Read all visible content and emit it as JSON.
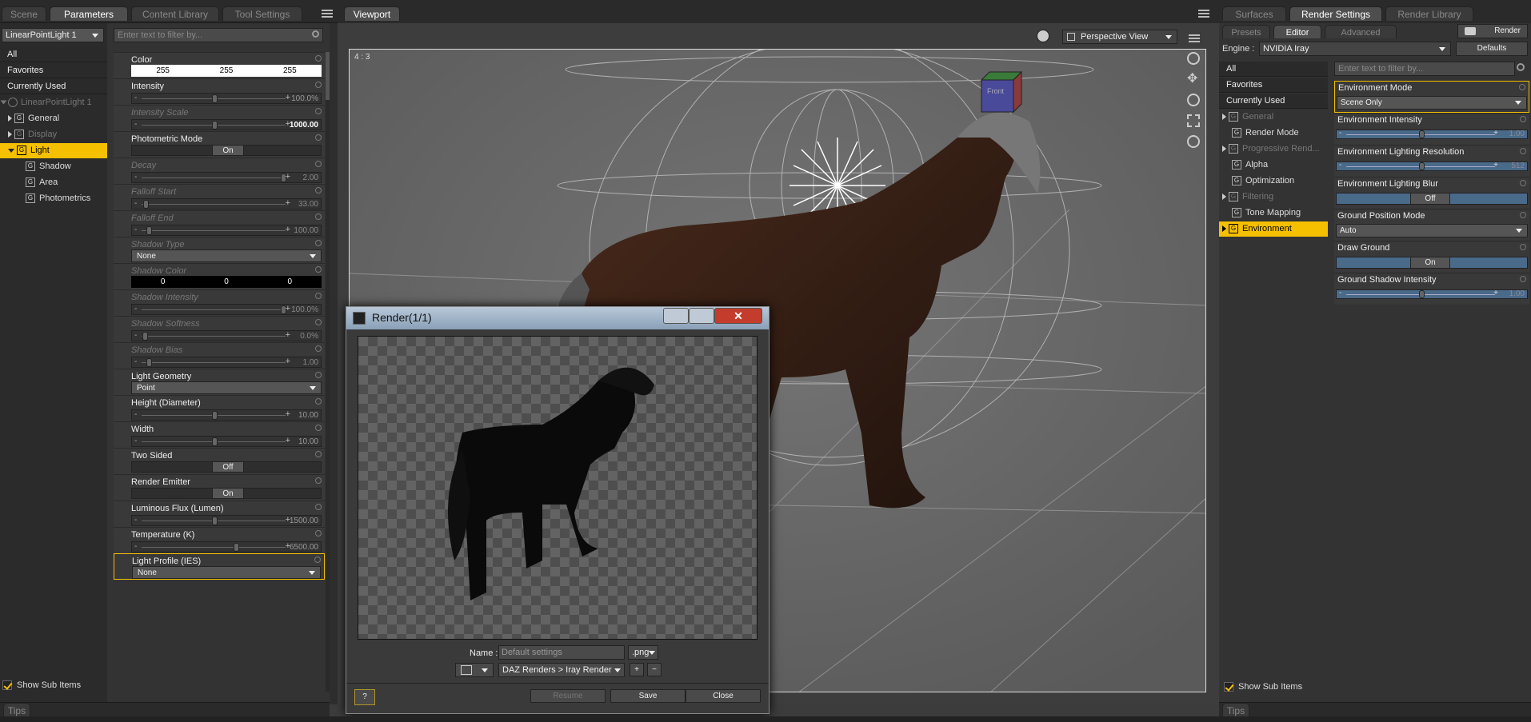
{
  "left_tabs": [
    "Scene",
    "Parameters",
    "Content Library",
    "Tool Settings"
  ],
  "left": {
    "selected_node": "LinearPointLight 1",
    "filter_placeholder": "Enter text to filter by...",
    "list": [
      "All",
      "Favorites",
      "Currently Used"
    ],
    "tree": {
      "root": "LinearPointLight 1",
      "items": [
        {
          "label": "General",
          "indent": 1,
          "state": "normal"
        },
        {
          "label": "Display",
          "indent": 1,
          "state": "dim"
        },
        {
          "label": "Light",
          "indent": 1,
          "state": "selected"
        },
        {
          "label": "Shadow",
          "indent": 2,
          "state": "normal"
        },
        {
          "label": "Area",
          "indent": 2,
          "state": "normal"
        },
        {
          "label": "Photometrics",
          "indent": 2,
          "state": "normal"
        }
      ]
    },
    "show_sub_items": "Show Sub Items"
  },
  "params": [
    {
      "label": "Color",
      "kind": "color",
      "values": [
        "255",
        "255",
        "255"
      ],
      "dim": false
    },
    {
      "label": "Intensity",
      "kind": "slider",
      "value": "100.0%",
      "pos": 0.5,
      "dim": false
    },
    {
      "label": "Intensity Scale",
      "kind": "slider",
      "value": "1000.00",
      "pos": 0.5,
      "dim": true
    },
    {
      "label": "Photometric Mode",
      "kind": "toggle",
      "value": "On",
      "dim": false
    },
    {
      "label": "Decay",
      "kind": "slider",
      "value": "2.00",
      "pos": 0.97,
      "dim": true
    },
    {
      "label": "Falloff Start",
      "kind": "slider",
      "value": "33.00",
      "pos": 0.03,
      "dim": true
    },
    {
      "label": "Falloff End",
      "kind": "slider",
      "value": "100.00",
      "pos": 0.05,
      "dim": true
    },
    {
      "label": "Shadow Type",
      "kind": "dropdown",
      "value": "None",
      "dim": true
    },
    {
      "label": "Shadow Color",
      "kind": "color_dark",
      "values": [
        "0",
        "0",
        "0"
      ],
      "dim": true
    },
    {
      "label": "Shadow Intensity",
      "kind": "slider",
      "value": "100.0%",
      "pos": 0.97,
      "dim": true
    },
    {
      "label": "Shadow Softness",
      "kind": "slider",
      "value": "0.0%",
      "pos": 0.02,
      "dim": true
    },
    {
      "label": "Shadow Bias",
      "kind": "slider",
      "value": "1.00",
      "pos": 0.05,
      "dim": true
    },
    {
      "label": "Light Geometry",
      "kind": "dropdown",
      "value": "Point",
      "dim": false
    },
    {
      "label": "Height (Diameter)",
      "kind": "slider",
      "value": "10.00",
      "pos": 0.5,
      "dim": false
    },
    {
      "label": "Width",
      "kind": "slider",
      "value": "10.00",
      "pos": 0.5,
      "dim": false
    },
    {
      "label": "Two Sided",
      "kind": "toggle",
      "value": "Off",
      "dim": false
    },
    {
      "label": "Render Emitter",
      "kind": "toggle",
      "value": "On",
      "dim": false
    },
    {
      "label": "Luminous Flux (Lumen)",
      "kind": "slider",
      "value": "1500.00",
      "pos": 0.5,
      "dim": false
    },
    {
      "label": "Temperature (K)",
      "kind": "slider",
      "value": "6500.00",
      "pos": 0.65,
      "dim": false
    },
    {
      "label": "Light Profile (IES)",
      "kind": "dropdown",
      "value": "None",
      "dim": false,
      "highlight": true
    }
  ],
  "viewport": {
    "tab": "Viewport",
    "aspect": "4 : 3",
    "view": "Perspective View",
    "cube_label": "Front"
  },
  "render_dialog": {
    "title": "Render(1/1)",
    "name_label": "Name :",
    "name_value": "Default settings",
    "ext": ".png",
    "path": "DAZ Renders > Iray Render",
    "plus": "+",
    "minus": "−",
    "help": "?",
    "resume": "Resume",
    "save": "Save",
    "close": "Close"
  },
  "right_tabs": [
    "Surfaces",
    "Render Settings",
    "Render Library"
  ],
  "right": {
    "subtabs": [
      "Presets",
      "Editor",
      "Advanced"
    ],
    "render_button": "Render",
    "engine_label": "Engine :",
    "engine_value": "NVIDIA Iray",
    "defaults_button": "Defaults",
    "filter_placeholder": "Enter text to filter by...",
    "list": [
      "All",
      "Favorites",
      "Currently Used"
    ],
    "tree": [
      {
        "label": "General",
        "state": "dim",
        "arrow": true
      },
      {
        "label": "Render Mode",
        "state": "normal",
        "arrow": false
      },
      {
        "label": "Progressive Rend...",
        "state": "dim",
        "arrow": true
      },
      {
        "label": "Alpha",
        "state": "normal",
        "arrow": false
      },
      {
        "label": "Optimization",
        "state": "normal",
        "arrow": false
      },
      {
        "label": "Filtering",
        "state": "dim",
        "arrow": true
      },
      {
        "label": "Tone Mapping",
        "state": "normal",
        "arrow": false
      },
      {
        "label": "Environment",
        "state": "selected",
        "arrow": true
      }
    ],
    "props": [
      {
        "label": "Environment Mode",
        "kind": "dropdown",
        "value": "Scene Only",
        "highlight": true
      },
      {
        "label": "Environment Intensity",
        "kind": "slider",
        "value": "1.00",
        "pos": 0.5
      },
      {
        "label": "Environment Lighting Resolution",
        "kind": "slider",
        "value": "512",
        "pos": 0.5
      },
      {
        "label": "Environment Lighting Blur",
        "kind": "toggle",
        "value": "Off"
      },
      {
        "label": "Ground Position Mode",
        "kind": "dropdown",
        "value": "Auto"
      },
      {
        "label": "Draw Ground",
        "kind": "toggle",
        "value": "On"
      },
      {
        "label": "Ground Shadow Intensity",
        "kind": "slider",
        "value": "1.00",
        "pos": 0.5
      }
    ],
    "show_sub_items": "Show Sub Items"
  },
  "tips": "Tips",
  "tips_right": "Tips"
}
